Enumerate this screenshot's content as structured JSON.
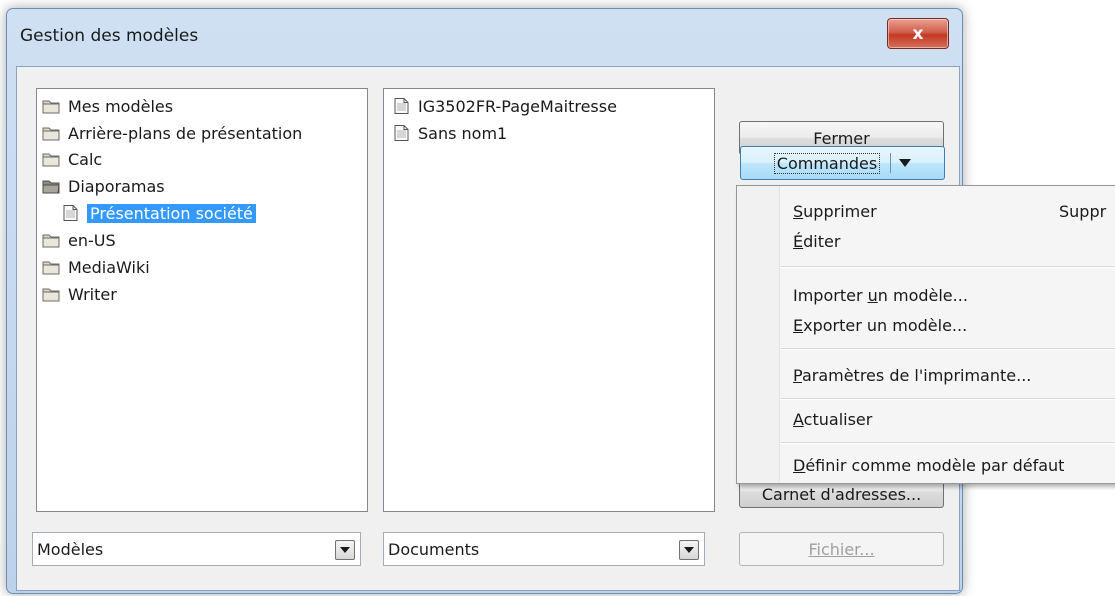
{
  "dialog": {
    "title": "Gestion des modèles",
    "close_symbol": "x"
  },
  "left_tree": {
    "items": [
      {
        "label": "Mes modèles",
        "icon": "folder-icon"
      },
      {
        "label": "Arrière-plans de présentation",
        "icon": "folder-icon"
      },
      {
        "label": "Calc",
        "icon": "folder-icon"
      },
      {
        "label": "Diaporamas",
        "icon": "folder-open-icon"
      },
      {
        "label": "Présentation société",
        "icon": "document-icon",
        "selected": true
      },
      {
        "label": "en-US",
        "icon": "folder-icon"
      },
      {
        "label": "MediaWiki",
        "icon": "folder-icon"
      },
      {
        "label": "Writer",
        "icon": "folder-icon"
      }
    ]
  },
  "right_list": {
    "items": [
      {
        "label": "IG3502FR-PageMaitresse",
        "icon": "document-icon"
      },
      {
        "label": "Sans nom1",
        "icon": "document-icon"
      }
    ]
  },
  "combos": {
    "left_value": "Modèles",
    "right_value": "Documents"
  },
  "buttons": {
    "close": "Fermer",
    "commands": "Commandes",
    "address_book_partial": "Carnet d'adresses...",
    "file": "Fichier..."
  },
  "menu": {
    "items": [
      {
        "pre": "",
        "u": "S",
        "post": "upprimer",
        "shortcut": "Suppr"
      },
      {
        "pre": "",
        "u": "É",
        "post": "diter",
        "shortcut": ""
      },
      {
        "pre": "Importer ",
        "u": "u",
        "post": "n modèle...",
        "shortcut": ""
      },
      {
        "pre": "",
        "u": "E",
        "post": "xporter un modèle...",
        "shortcut": ""
      },
      {
        "pre": "",
        "u": "P",
        "post": "aramètres de l'imprimante...",
        "shortcut": ""
      },
      {
        "pre": "",
        "u": "A",
        "post": "ctualiser",
        "shortcut": ""
      },
      {
        "pre": "",
        "u": "D",
        "post": "éfinir comme modèle par défaut",
        "shortcut": ""
      }
    ]
  },
  "colors": {
    "selection": "#3399ff",
    "window_frame": "#bcd2ec",
    "close_button": "#c23a23"
  }
}
